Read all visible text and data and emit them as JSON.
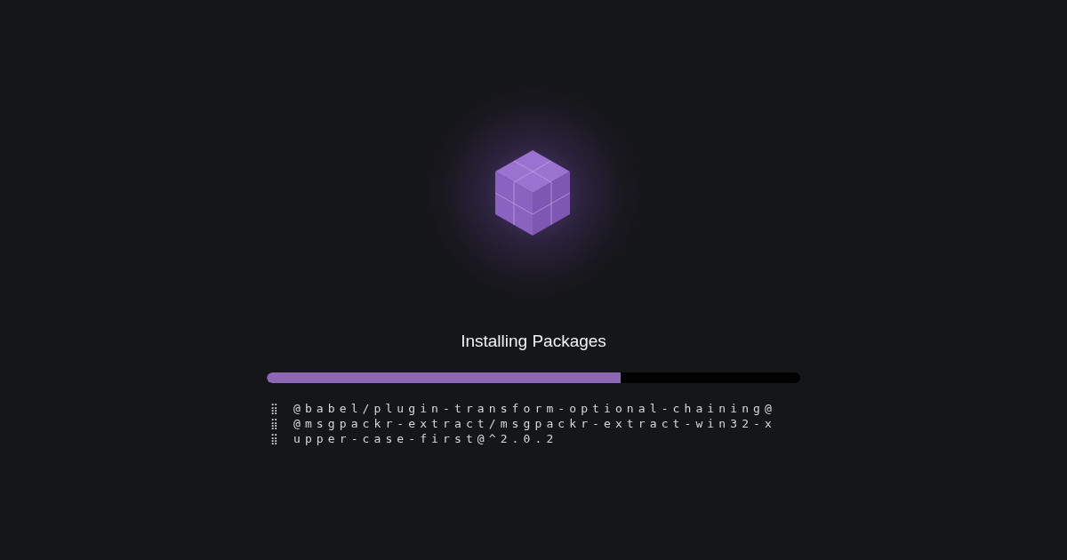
{
  "title": "Installing Packages",
  "progress": {
    "level": 0.663
  },
  "log": [
    {
      "spinner": "⣿",
      "text": "@babel/plugin-transform-optional-chaining@"
    },
    {
      "spinner": "⣿",
      "text": "@msgpackr-extract/msgpackr-extract-win32-x"
    },
    {
      "spinner": "⣿",
      "text": "upper-case-first@^2.0.2"
    }
  ]
}
